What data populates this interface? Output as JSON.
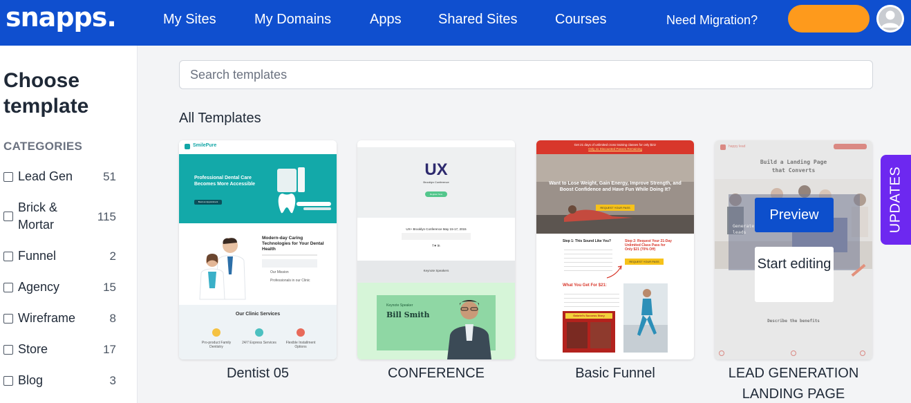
{
  "header": {
    "logo": "snapps.",
    "nav": [
      "My Sites",
      "My Domains",
      "Apps",
      "Shared Sites",
      "Courses"
    ],
    "migration": "Need Migration?",
    "cta_label": ""
  },
  "sidebar": {
    "title": "Choose template",
    "categories_heading": "CATEGORIES",
    "categories": [
      {
        "label": "Lead Gen",
        "count": "51"
      },
      {
        "label": "Brick & Mortar",
        "count": "115"
      },
      {
        "label": "Funnel",
        "count": "2"
      },
      {
        "label": "Agency",
        "count": "15"
      },
      {
        "label": "Wireframe",
        "count": "8"
      },
      {
        "label": "Store",
        "count": "17"
      },
      {
        "label": "Blog",
        "count": "3"
      }
    ]
  },
  "search": {
    "placeholder": "Search templates"
  },
  "section_title": "All Templates",
  "templates": [
    {
      "name": "Dentist 05"
    },
    {
      "name": "CONFERENCE"
    },
    {
      "name": "Basic Funnel"
    },
    {
      "name": "LEAD GENERATION LANDING PAGE"
    }
  ],
  "thumb_dentist": {
    "brand": "SmilePure",
    "hero": "Professional Dental Care Becomes More Accessible",
    "button": "Book an Appointment",
    "sub": "Modern-day Caring Technologies for Your Dental Health",
    "line1": "Our Mission",
    "line2": "Professionals in our Clinic",
    "services": "Our Clinic Services",
    "svc1": "Pro-product Family Dentistry",
    "svc2": "24/7 Express Services",
    "svc3": "Flexible Installment Options"
  },
  "thumb_conference": {
    "logo": "UX",
    "logo_sub": "Brooklyn Conference",
    "button": "Register Now",
    "date": "UX+ Brooklyn Conference May 15-17, 2015",
    "speakers": "Keynote Speakers",
    "speaker_role": "Keynote Speaker",
    "speaker": "Bill Smith"
  },
  "thumb_funnel": {
    "banner1": "Get 21 days of unlimited cross training classes for only $21!",
    "banner2": "Only 11 Discounted Passes Remaining",
    "hero": "Want to Lose Weight, Gain Energy, Improve Strength, and Boost Confidence and Have Fun While Doing It?",
    "button": "REQUEST YOUR PASS",
    "step1": "Step 1: This Sound Like You?",
    "step2": "Step 2: Request Your 21-Day Unlimited Class Pass for Only $21 (70% Off)",
    "step2_button": "REQUEST YOUR PASS",
    "get": "What You Get For $21:",
    "story": "Gabriel's Success Story"
  },
  "thumb_lead": {
    "brand": "happy lead",
    "headline": "Build a Landing Page that Converts",
    "overlay_text": "Generate strong leads",
    "describe": "Describe the benefits",
    "preview": "Preview",
    "edit": "Start editing"
  },
  "updates": "UPDATES",
  "colors": {
    "header": "#0f4fcf",
    "cta": "#fe9a1c",
    "updates": "#6d28f0",
    "teal": "#12a6a6"
  }
}
